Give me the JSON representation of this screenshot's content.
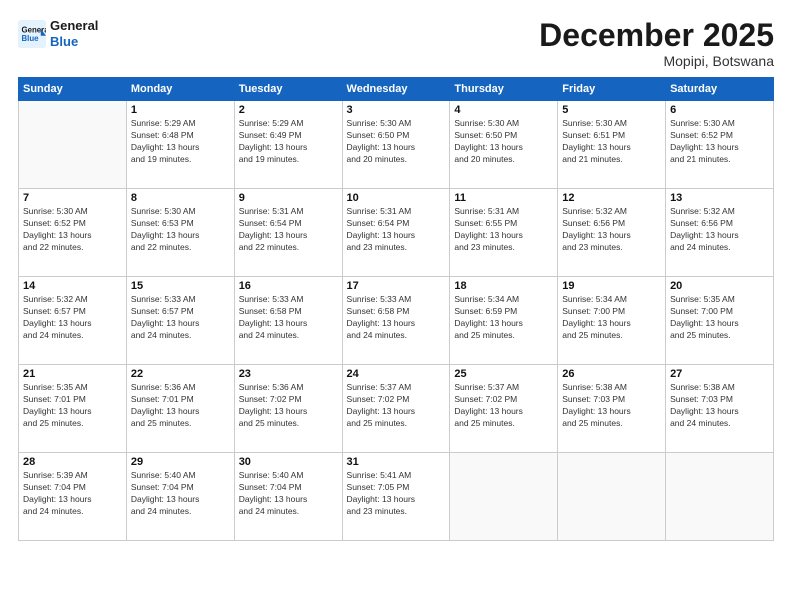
{
  "header": {
    "logo_line1": "General",
    "logo_line2": "Blue",
    "title": "December 2025",
    "subtitle": "Mopipi, Botswana"
  },
  "days_of_week": [
    "Sunday",
    "Monday",
    "Tuesday",
    "Wednesday",
    "Thursday",
    "Friday",
    "Saturday"
  ],
  "weeks": [
    [
      {
        "day": "",
        "info": ""
      },
      {
        "day": "1",
        "info": "Sunrise: 5:29 AM\nSunset: 6:48 PM\nDaylight: 13 hours\nand 19 minutes."
      },
      {
        "day": "2",
        "info": "Sunrise: 5:29 AM\nSunset: 6:49 PM\nDaylight: 13 hours\nand 19 minutes."
      },
      {
        "day": "3",
        "info": "Sunrise: 5:30 AM\nSunset: 6:50 PM\nDaylight: 13 hours\nand 20 minutes."
      },
      {
        "day": "4",
        "info": "Sunrise: 5:30 AM\nSunset: 6:50 PM\nDaylight: 13 hours\nand 20 minutes."
      },
      {
        "day": "5",
        "info": "Sunrise: 5:30 AM\nSunset: 6:51 PM\nDaylight: 13 hours\nand 21 minutes."
      },
      {
        "day": "6",
        "info": "Sunrise: 5:30 AM\nSunset: 6:52 PM\nDaylight: 13 hours\nand 21 minutes."
      }
    ],
    [
      {
        "day": "7",
        "info": "Sunrise: 5:30 AM\nSunset: 6:52 PM\nDaylight: 13 hours\nand 22 minutes."
      },
      {
        "day": "8",
        "info": "Sunrise: 5:30 AM\nSunset: 6:53 PM\nDaylight: 13 hours\nand 22 minutes."
      },
      {
        "day": "9",
        "info": "Sunrise: 5:31 AM\nSunset: 6:54 PM\nDaylight: 13 hours\nand 22 minutes."
      },
      {
        "day": "10",
        "info": "Sunrise: 5:31 AM\nSunset: 6:54 PM\nDaylight: 13 hours\nand 23 minutes."
      },
      {
        "day": "11",
        "info": "Sunrise: 5:31 AM\nSunset: 6:55 PM\nDaylight: 13 hours\nand 23 minutes."
      },
      {
        "day": "12",
        "info": "Sunrise: 5:32 AM\nSunset: 6:56 PM\nDaylight: 13 hours\nand 23 minutes."
      },
      {
        "day": "13",
        "info": "Sunrise: 5:32 AM\nSunset: 6:56 PM\nDaylight: 13 hours\nand 24 minutes."
      }
    ],
    [
      {
        "day": "14",
        "info": "Sunrise: 5:32 AM\nSunset: 6:57 PM\nDaylight: 13 hours\nand 24 minutes."
      },
      {
        "day": "15",
        "info": "Sunrise: 5:33 AM\nSunset: 6:57 PM\nDaylight: 13 hours\nand 24 minutes."
      },
      {
        "day": "16",
        "info": "Sunrise: 5:33 AM\nSunset: 6:58 PM\nDaylight: 13 hours\nand 24 minutes."
      },
      {
        "day": "17",
        "info": "Sunrise: 5:33 AM\nSunset: 6:58 PM\nDaylight: 13 hours\nand 24 minutes."
      },
      {
        "day": "18",
        "info": "Sunrise: 5:34 AM\nSunset: 6:59 PM\nDaylight: 13 hours\nand 25 minutes."
      },
      {
        "day": "19",
        "info": "Sunrise: 5:34 AM\nSunset: 7:00 PM\nDaylight: 13 hours\nand 25 minutes."
      },
      {
        "day": "20",
        "info": "Sunrise: 5:35 AM\nSunset: 7:00 PM\nDaylight: 13 hours\nand 25 minutes."
      }
    ],
    [
      {
        "day": "21",
        "info": "Sunrise: 5:35 AM\nSunset: 7:01 PM\nDaylight: 13 hours\nand 25 minutes."
      },
      {
        "day": "22",
        "info": "Sunrise: 5:36 AM\nSunset: 7:01 PM\nDaylight: 13 hours\nand 25 minutes."
      },
      {
        "day": "23",
        "info": "Sunrise: 5:36 AM\nSunset: 7:02 PM\nDaylight: 13 hours\nand 25 minutes."
      },
      {
        "day": "24",
        "info": "Sunrise: 5:37 AM\nSunset: 7:02 PM\nDaylight: 13 hours\nand 25 minutes."
      },
      {
        "day": "25",
        "info": "Sunrise: 5:37 AM\nSunset: 7:02 PM\nDaylight: 13 hours\nand 25 minutes."
      },
      {
        "day": "26",
        "info": "Sunrise: 5:38 AM\nSunset: 7:03 PM\nDaylight: 13 hours\nand 25 minutes."
      },
      {
        "day": "27",
        "info": "Sunrise: 5:38 AM\nSunset: 7:03 PM\nDaylight: 13 hours\nand 24 minutes."
      }
    ],
    [
      {
        "day": "28",
        "info": "Sunrise: 5:39 AM\nSunset: 7:04 PM\nDaylight: 13 hours\nand 24 minutes."
      },
      {
        "day": "29",
        "info": "Sunrise: 5:40 AM\nSunset: 7:04 PM\nDaylight: 13 hours\nand 24 minutes."
      },
      {
        "day": "30",
        "info": "Sunrise: 5:40 AM\nSunset: 7:04 PM\nDaylight: 13 hours\nand 24 minutes."
      },
      {
        "day": "31",
        "info": "Sunrise: 5:41 AM\nSunset: 7:05 PM\nDaylight: 13 hours\nand 23 minutes."
      },
      {
        "day": "",
        "info": ""
      },
      {
        "day": "",
        "info": ""
      },
      {
        "day": "",
        "info": ""
      }
    ]
  ]
}
